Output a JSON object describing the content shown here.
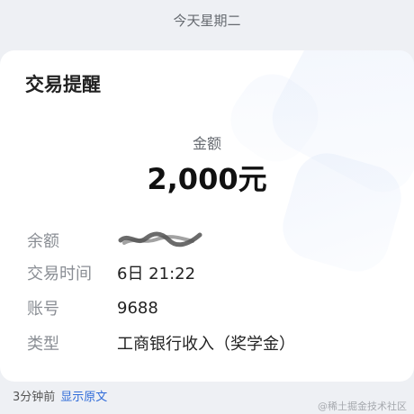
{
  "header": {
    "date_text": "今天星期二"
  },
  "card": {
    "title": "交易提醒",
    "amount_label": "金额",
    "amount_value": "2,000元",
    "details": [
      {
        "key": "余额",
        "value": ""
      },
      {
        "key": "交易时间",
        "value": "6日 21:22"
      },
      {
        "key": "账号",
        "value": "9688"
      },
      {
        "key": "类型",
        "value": "工商银行收入（奖学金）"
      }
    ]
  },
  "footer": {
    "time_ago": "3分钟前",
    "show_original_label": "显示原文",
    "watermark": "@稀土掘金技术社区"
  },
  "colors": {
    "background": "#eef0f4",
    "card": "#ffffff",
    "link": "#2f6bd9"
  }
}
